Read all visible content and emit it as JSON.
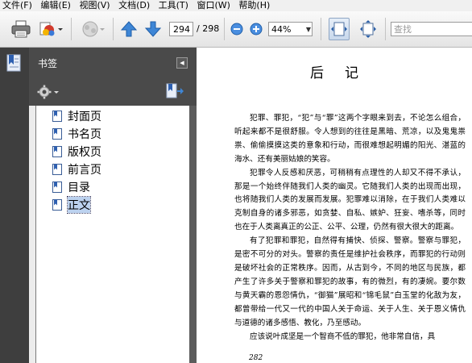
{
  "menu": [
    "文件(F)",
    "编辑(E)",
    "视图(V)",
    "文档(D)",
    "工具(T)",
    "窗口(W)",
    "帮助(H)"
  ],
  "toolbar": {
    "current_page": "294",
    "total_pages": "/ 298",
    "zoom": "44%",
    "search_placeholder": "查找"
  },
  "bookmarks_panel": {
    "title": "书签",
    "items": [
      {
        "label": "封面页",
        "selected": false
      },
      {
        "label": "书名页",
        "selected": false
      },
      {
        "label": "版权页",
        "selected": false
      },
      {
        "label": "前言页",
        "selected": false
      },
      {
        "label": "目录",
        "selected": false
      },
      {
        "label": "正文",
        "selected": true
      }
    ]
  },
  "document": {
    "title": "后记",
    "paragraphs": [
      "犯罪、罪犯，“犯”与“罪”这两个字眼来到去，不论怎么组合，听起来都不是很舒服。令人想到的往往是黑暗、荒凉，以及鬼鬼祟祟、偷偷摸摸这类的意象和行动，而很难想起明媚的阳光、湛蓝的海水、还有美丽姑娘的笑容。",
      "犯罪令人反感和厌恶，可稍稍有点理性的人却又不得不承认，那是一个始终伴随我们人类的幽灵。它随我们人类的出现而出现，也将随我们人类的发展而发展。犯罪难以消除，在于我们人类难以克制自身的诸多邪恶，如贪婪、自私、嫉妒、狂妄、嗜杀等，同时也在于人类离真正的公正、公平、公理，仍然有很大很大的距离。",
      "有了犯罪和罪犯，自然得有捕快、侦探、警察。警察与罪犯，是密不可分的对头。警察的责任是维护社会秩序，而罪犯的行动则是破坏社会的正常秩序。因而，从古到今，不同的地区与民族，都产生了许多关于警察和罪犯的故事，有的微烈，有的凄婉。要尔数与黄天霸的恩怨情仇，“御猫”展昭和“锦毛鼠”白玉堂的化敌为友，都曾带给一代又一代的中国人关于命运、关于人生、关于恩义情仇与道德的诸多感悟、教化，乃至感动。",
      "应该说叶成坚是一个智商不低的罪犯，他非常自信，具"
    ],
    "page_number": "282"
  },
  "colors": {
    "panel_dark": "#4a4a4a",
    "rail": "#3e3e3e",
    "selection": "#bcd2ef",
    "page_bg": "#ffffff"
  },
  "icons": [
    "printer-icon",
    "create-pdf-icon",
    "collaborate-icon",
    "prev-page-icon",
    "next-page-icon",
    "zoom-out-icon",
    "zoom-in-icon",
    "fit-width-icon",
    "fit-page-icon",
    "bookmarks-icon",
    "options-gear-icon",
    "expand-bookmark-icon",
    "bookmark-icon"
  ]
}
